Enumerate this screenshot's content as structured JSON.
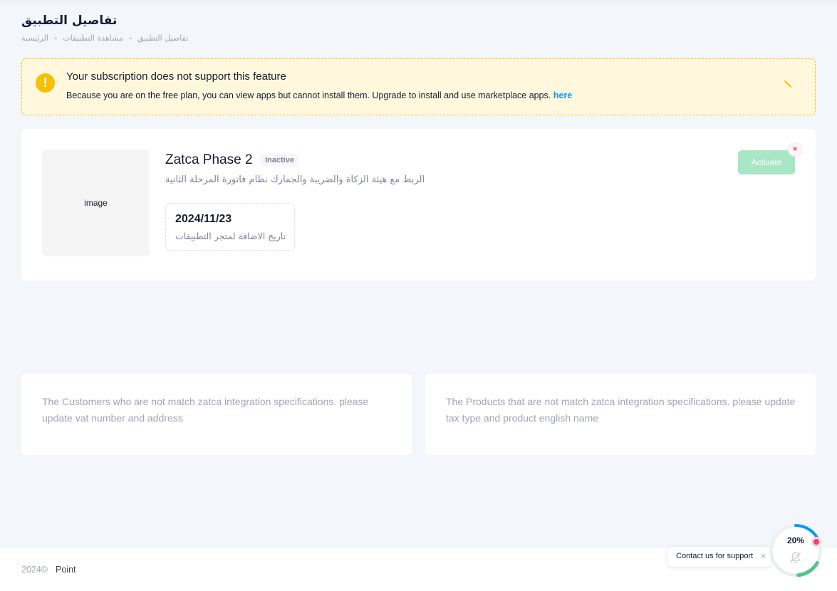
{
  "header": {
    "title": "تفاصيل التطبيق",
    "breadcrumb": [
      "الرئيسية",
      "مشاهدة التطبيقات",
      "تفاصيل التطبيق"
    ],
    "separator": "-"
  },
  "alert": {
    "title": "Your subscription does not support this feature",
    "text": "Because you are on the free plan, you can view apps but cannot install them. Upgrade to install and use marketplace apps.",
    "link": "here",
    "icon_symbol": "!",
    "icon": "exclamation-icon",
    "close_icon": "close-icon",
    "color": "#f6c000"
  },
  "app": {
    "image_alt": "image",
    "name": "Zatca Phase 2",
    "status": "Inactive",
    "description": "الربط مع هيئة الزكاة والضريبة والجمارك نظام فاتورة المرحلة الثانية",
    "date_value": "2024/11/23",
    "date_label": "تاريخ الاضافة لمتجر التطبيقات",
    "activate_label": "Activate",
    "required_marker": "*",
    "activate_color": "#a8e6c5"
  },
  "info_cards": {
    "customers": "The Customers who are not match zatca integration specifications. please update vat number and address",
    "products": "The Products that are not match zatca integration specifications. please update tax type and product english name"
  },
  "footer": {
    "copyright": "2024©",
    "brand": "Point"
  },
  "support": {
    "label": "Contact us for support",
    "close": "×",
    "progress_label": "20%",
    "progress_fraction": 0.2,
    "ring_color": "#009ef7",
    "ring_secondary_color": "#50cd89",
    "icon": "bell-icon"
  }
}
